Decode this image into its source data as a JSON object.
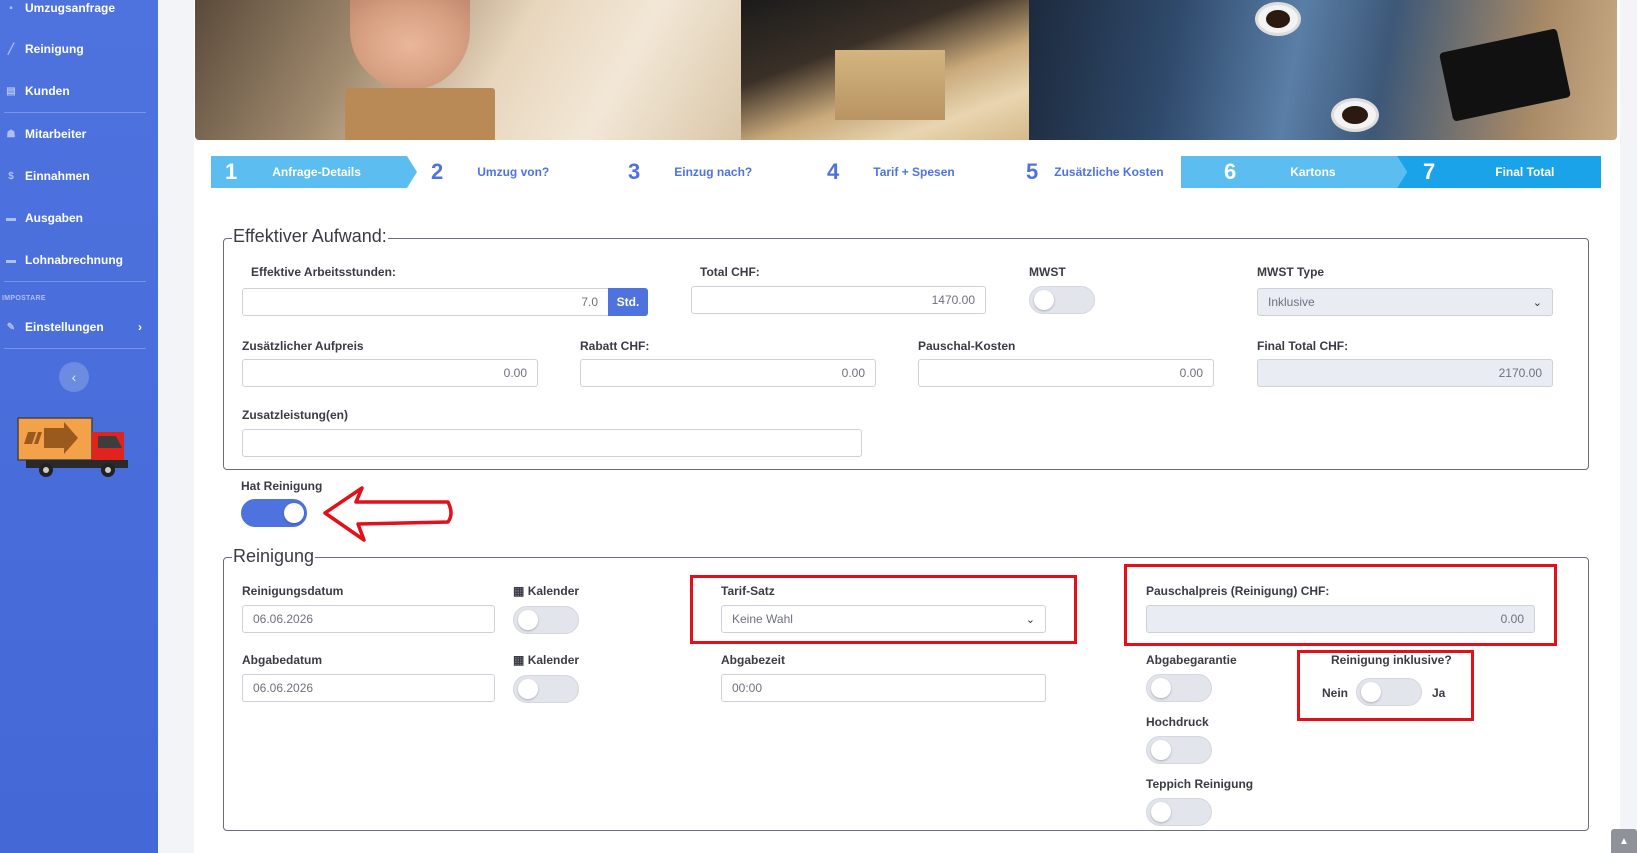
{
  "sidebar": {
    "items": [
      {
        "label": "Umzugsanfrage",
        "icon": "truck-icon"
      },
      {
        "label": "Reinigung",
        "icon": "broom-icon"
      },
      {
        "label": "Kunden",
        "icon": "address-book-icon"
      },
      {
        "label": "Mitarbeiter",
        "icon": "users-icon"
      },
      {
        "label": "Einnahmen",
        "icon": "dollar-icon"
      },
      {
        "label": "Ausgaben",
        "icon": "wallet-icon"
      },
      {
        "label": "Lohnabrechnung",
        "icon": "money-icon"
      }
    ],
    "heading": "IMPOSTARE",
    "settings": {
      "label": "Einstellungen",
      "arrow": "›"
    },
    "collapse_glyph": "‹"
  },
  "steps": [
    {
      "num": "1",
      "label": "Anfrage-Details",
      "state": "done"
    },
    {
      "num": "2",
      "label": "Umzug von?",
      "state": "inactive"
    },
    {
      "num": "3",
      "label": "Einzug nach?",
      "state": "inactive"
    },
    {
      "num": "4",
      "label": "Tarif + Spesen",
      "state": "inactive"
    },
    {
      "num": "5",
      "label": "Zusätzliche Kosten",
      "state": "inactive"
    },
    {
      "num": "6",
      "label": "Kartons",
      "state": "done"
    },
    {
      "num": "7",
      "label": "Final Total",
      "state": "active"
    }
  ],
  "aufwand": {
    "legend": "Effektiver Aufwand:",
    "arbeitsstunden": {
      "label": "Effektive Arbeitsstunden:",
      "value": "7.0",
      "unit": "Std."
    },
    "total": {
      "label": "Total CHF:",
      "value": "1470.00"
    },
    "mwst": {
      "label": "MWST",
      "on": false
    },
    "mwst_type": {
      "label": "MWST Type",
      "value": "Inklusive"
    },
    "aufpreis": {
      "label": "Zusätzlicher Aufpreis",
      "value": "0.00"
    },
    "rabatt": {
      "label": "Rabatt CHF:",
      "value": "0.00"
    },
    "pauschal": {
      "label": "Pauschal-Kosten",
      "value": "0.00"
    },
    "final_total": {
      "label": "Final Total CHF:",
      "value": "2170.00"
    },
    "zusatzleistungen": {
      "label": "Zusatzleistung(en)",
      "value": ""
    }
  },
  "hat_reinigung": {
    "label": "Hat Reinigung",
    "on": true
  },
  "reinigung": {
    "legend": "Reinigung",
    "reinigungsdatum": {
      "label": "Reinigungsdatum",
      "value": "06.06.2026"
    },
    "kalender1": {
      "label": "Kalender",
      "on": false
    },
    "tarif_satz": {
      "label": "Tarif-Satz",
      "value": "Keine Wahl"
    },
    "pauschalpreis": {
      "label": "Pauschalpreis (Reinigung) CHF:",
      "value": "0.00"
    },
    "abgabedatum": {
      "label": "Abgabedatum",
      "value": "06.06.2026"
    },
    "kalender2": {
      "label": "Kalender",
      "on": false
    },
    "abgabezeit": {
      "label": "Abgabezeit",
      "value": "00:00"
    },
    "abgabegarantie": {
      "label": "Abgabegarantie",
      "on": false
    },
    "inklusive": {
      "label": "Reinigung inklusive?",
      "no": "Nein",
      "yes": "Ja",
      "on": false
    },
    "hochdruck": {
      "label": "Hochdruck",
      "on": false
    },
    "teppich": {
      "label": "Teppich Reinigung",
      "on": false
    }
  },
  "colors": {
    "primary": "#4e73df",
    "step_done": "#5bbdf0",
    "step_active": "#1aa3e8",
    "annotation": "#e3101a"
  }
}
